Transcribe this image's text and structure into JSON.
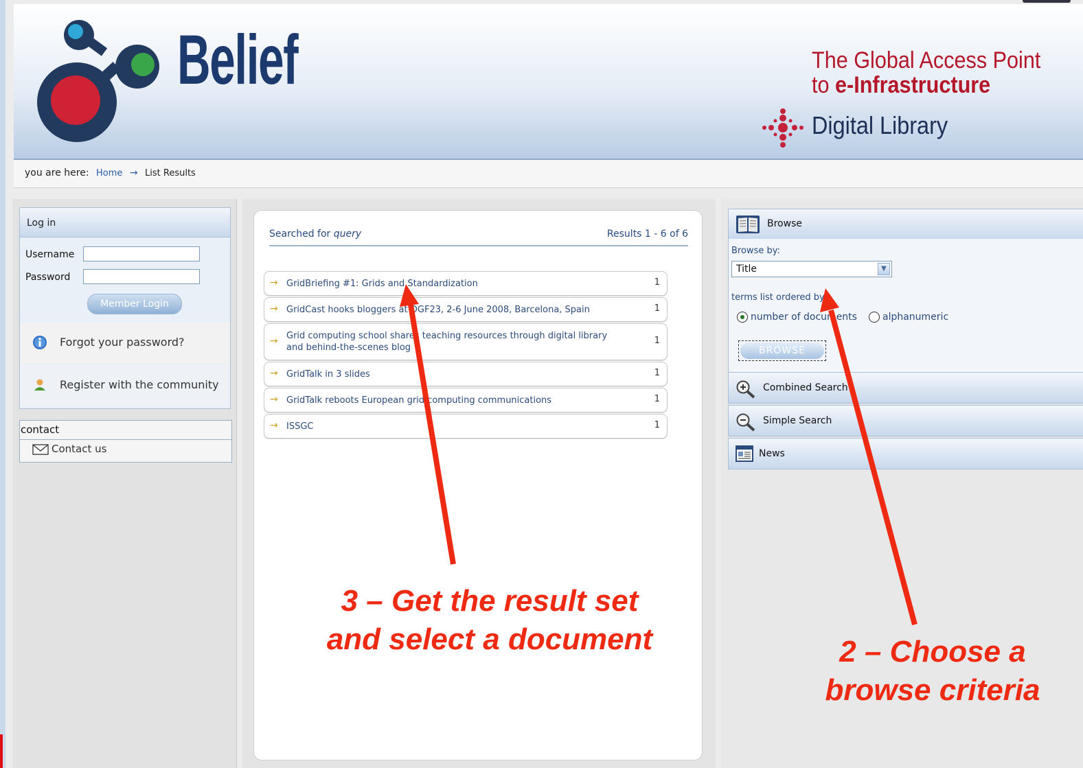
{
  "header": {
    "brand": "Belief",
    "tagline_line1": "The Global Access Point",
    "tagline_line2_prefix": "to ",
    "tagline_line2_bold": "e-Infrastructure",
    "subtitle": "Digital Library",
    "colors": {
      "brand": "#1c3a6e",
      "tagline": "#b5172a"
    }
  },
  "breadcrumb": {
    "prefix": "you are here:",
    "home": "Home",
    "current": "List Results"
  },
  "login": {
    "title": "Log in",
    "username_label": "Username",
    "password_label": "Password",
    "username_value": "",
    "password_value": "",
    "button": "Member Login",
    "forgot": "Forgot your password?",
    "register": "Register with the community"
  },
  "contact": {
    "title": "contact",
    "link": "Contact us"
  },
  "results": {
    "searched_prefix": "Searched for ",
    "query": "query",
    "summary": "Results 1 - 6 of 6",
    "items": [
      {
        "title": "GridBriefing #1: Grids and Standardization",
        "count": "1"
      },
      {
        "title": "GridCast hooks bloggers at OGF23, 2-6 June 2008, Barcelona, Spain",
        "count": "1"
      },
      {
        "title": "Grid computing school shares teaching resources through digital library and behind-the-scenes blog",
        "count": "1"
      },
      {
        "title": "GridTalk in 3 slides",
        "count": "1"
      },
      {
        "title": "GridTalk reboots European grid computing communications",
        "count": "1"
      },
      {
        "title": "ISSGC",
        "count": "1"
      }
    ]
  },
  "browse": {
    "title": "Browse",
    "browse_by_label": "Browse by:",
    "browse_by_value": "Title",
    "order_label": "terms list ordered by",
    "option_docs": "number of documents",
    "option_alpha": "alphanumeric",
    "selected_option": "number of documents",
    "button": "BROWSE"
  },
  "accordion": {
    "combined": "Combined Search",
    "simple": "Simple Search",
    "news": "News"
  },
  "annotations": {
    "step3_line1": "3 – Get the result set",
    "step3_line2": "and select a document",
    "step2_line1": "2 – Choose a",
    "step2_line2": "browse criteria",
    "color": "#ef2a12"
  },
  "icons": [
    "belief-logo-icon",
    "digital-library-icon",
    "breadcrumb-arrow-icon",
    "info-icon",
    "user-icon",
    "envelope-icon",
    "result-arrow-icon",
    "book-icon",
    "select-dropdown-icon",
    "zoom-in-icon",
    "zoom-out-icon",
    "news-icon"
  ]
}
